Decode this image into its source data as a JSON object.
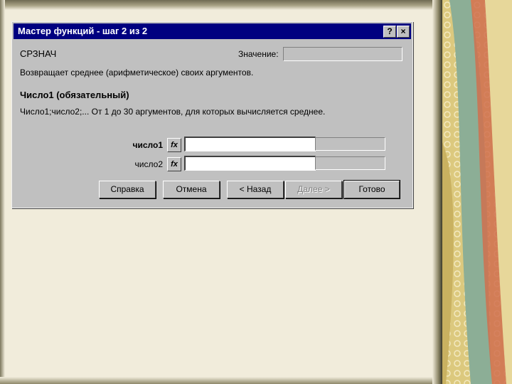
{
  "dialog": {
    "title": "Мастер функций - шаг 2 из 2",
    "help_button": "?",
    "close_button": "×",
    "function_name": "СРЗНАЧ",
    "value_label": "Значение:",
    "value": "",
    "description": "Возвращает среднее (арифметическое) своих аргументов.",
    "arg_title": "Число1 (обязательный)",
    "arg_description": "Число1;число2;... От 1 до 30 аргументов, для которых вычисляется среднее.",
    "args": [
      {
        "label": "число1",
        "fx": "fx",
        "value": "",
        "result": ""
      },
      {
        "label": "число2",
        "fx": "fx",
        "value": "",
        "result": ""
      }
    ],
    "buttons": {
      "help": "Справка",
      "cancel": "Отмена",
      "back": "< Назад",
      "next": "Далее >",
      "done": "Готово"
    }
  },
  "colors": {
    "titlebar": "#000080",
    "dialog_face": "#c0c0c0",
    "slide_background": "#f1ecdb",
    "decor_gold": "#d9c272",
    "decor_green": "#7fa58a",
    "decor_red": "#c9664e"
  }
}
